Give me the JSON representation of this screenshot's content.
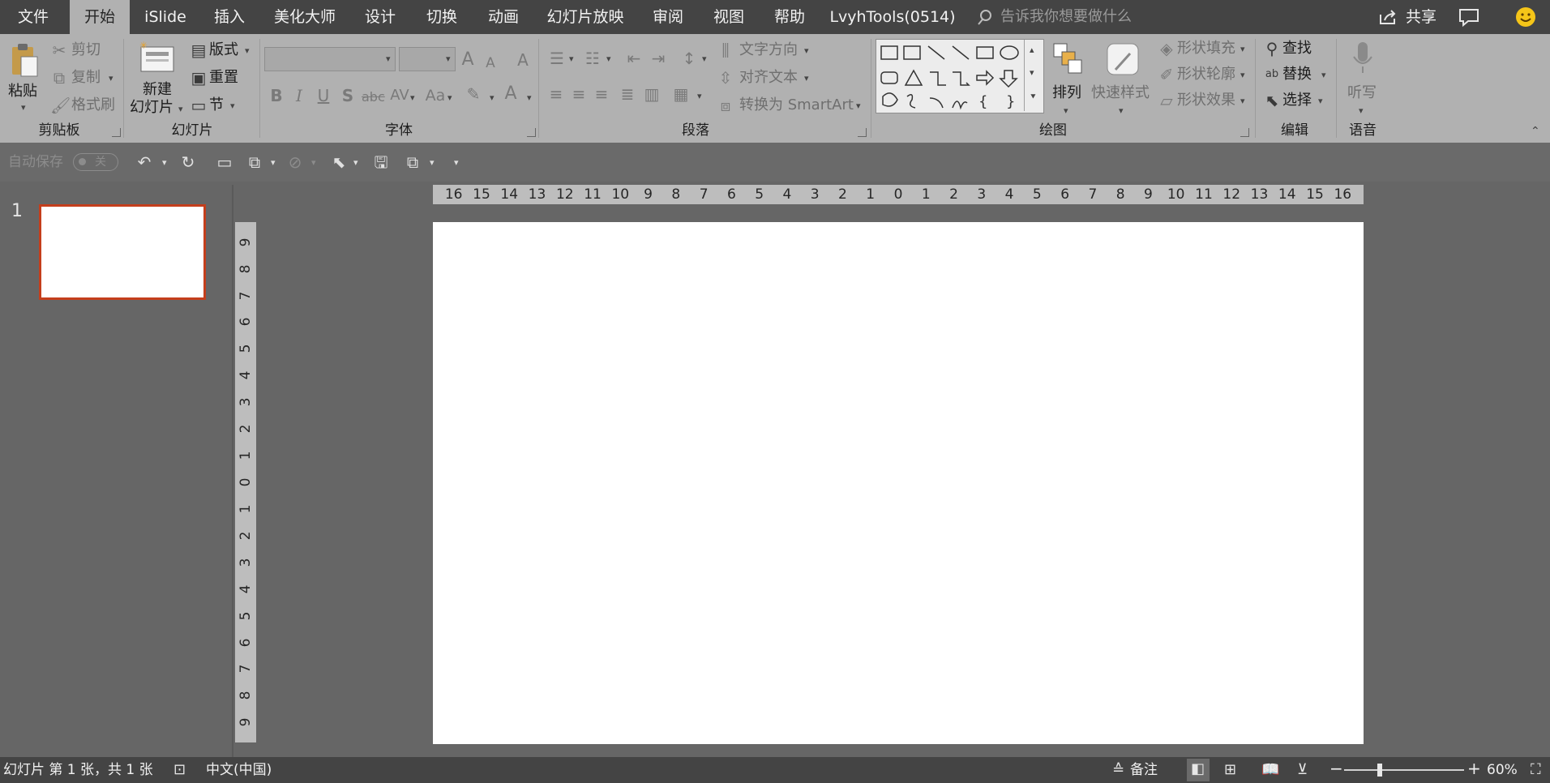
{
  "tabs": [
    "文件",
    "开始",
    "iSlide",
    "插入",
    "美化大师",
    "设计",
    "切换",
    "动画",
    "幻灯片放映",
    "审阅",
    "视图",
    "帮助",
    "LvyhTools(0514)"
  ],
  "tell_me_placeholder": "告诉我你想要做什么",
  "share_label": "共享",
  "ribbon": {
    "clipboard": {
      "paste": "粘贴",
      "cut": "剪切",
      "copy": "复制",
      "format_painter": "格式刷",
      "group": "剪贴板"
    },
    "slides": {
      "new_slide_line1": "新建",
      "new_slide_line2": "幻灯片",
      "layout": "版式",
      "reset": "重置",
      "section": "节",
      "group": "幻灯片"
    },
    "font": {
      "group": "字体",
      "bold": "B",
      "italic": "I",
      "underline": "U",
      "shadow": "S",
      "strike": "abc",
      "spacing": "AV",
      "case": "Aa",
      "grow": "A",
      "shrink": "A",
      "clear": "A"
    },
    "paragraph": {
      "text_direction": "文字方向",
      "align_text": "对齐文本",
      "smartart": "转换为 SmartArt",
      "group": "段落"
    },
    "drawing": {
      "arrange": "排列",
      "quick_styles": "快速样式",
      "fill": "形状填充",
      "outline": "形状轮廓",
      "effects": "形状效果",
      "group": "绘图"
    },
    "editing": {
      "find": "查找",
      "replace": "替换",
      "select": "选择",
      "group": "编辑"
    },
    "voice": {
      "dictate": "听写",
      "group": "语音"
    }
  },
  "qat": {
    "autosave": "自动保存",
    "autosave_state": "关"
  },
  "slide_number": "1",
  "hruler": [
    "16",
    "15",
    "14",
    "13",
    "12",
    "11",
    "10",
    "9",
    "8",
    "7",
    "6",
    "5",
    "4",
    "3",
    "2",
    "1",
    "0",
    "1",
    "2",
    "3",
    "4",
    "5",
    "6",
    "7",
    "8",
    "9",
    "10",
    "11",
    "12",
    "13",
    "14",
    "15",
    "16"
  ],
  "vruler": [
    "9",
    "8",
    "7",
    "6",
    "5",
    "4",
    "3",
    "2",
    "1",
    "0",
    "1",
    "2",
    "3",
    "4",
    "5",
    "6",
    "7",
    "8",
    "9"
  ],
  "status": {
    "slide_info": "幻灯片 第 1 张，共 1 张",
    "language": "中文(中国)",
    "notes": "备注",
    "zoom": "60%",
    "zoom_level": 0.6
  },
  "colors": {
    "ribbon": "#b1b1b1",
    "titlebar": "#444444",
    "workspace": "#666666",
    "accent": "#c43e1c"
  }
}
